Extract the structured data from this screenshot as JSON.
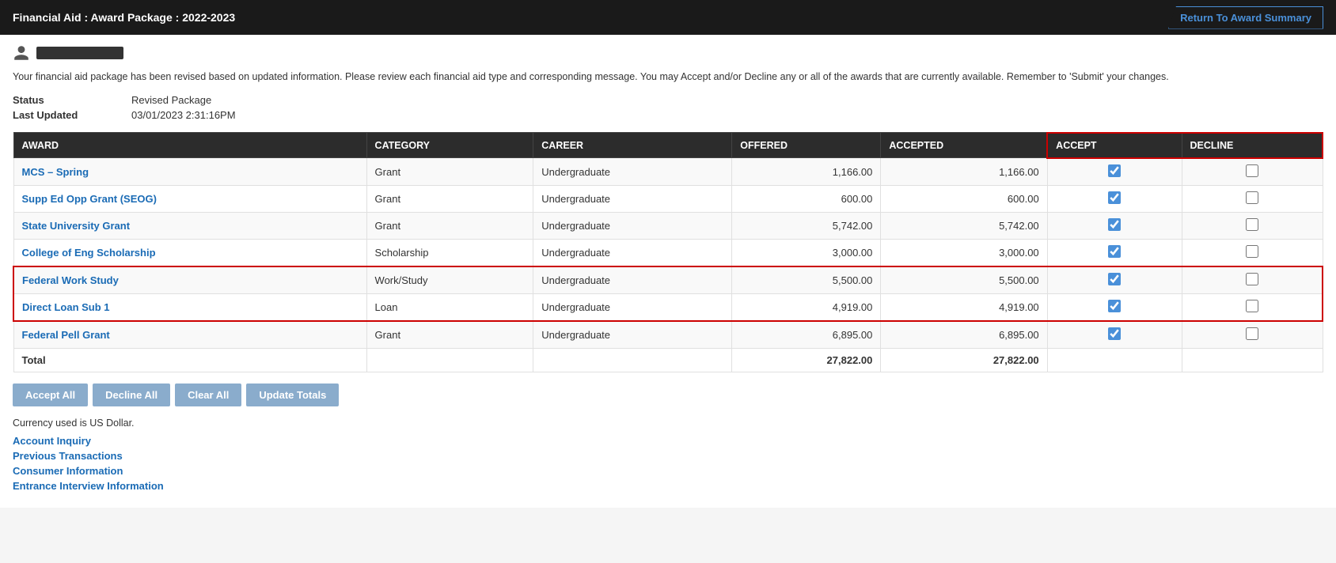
{
  "header": {
    "title": "Financial Aid  :  Award Package  :  2022-2023",
    "return_button_label": "Return To Award Summary"
  },
  "info_text": "Your financial aid package has been revised based on updated information. Please review each financial aid type and corresponding message. You may Accept and/or Decline any or all of the awards that are currently available. Remember to 'Submit' your changes.",
  "status": {
    "label": "Status",
    "value": "Revised Package"
  },
  "last_updated": {
    "label": "Last Updated",
    "value": "03/01/2023  2:31:16PM"
  },
  "table": {
    "columns": {
      "award": "AWARD",
      "category": "CATEGORY",
      "career": "CAREER",
      "offered": "OFFERED",
      "accepted": "ACCEPTED",
      "accept": "ACCEPT",
      "decline": "DECLINE"
    },
    "rows": [
      {
        "award": "MCS – Spring",
        "category": "Grant",
        "career": "Undergraduate",
        "offered": "1,166.00",
        "accepted": "1,166.00",
        "accept": true,
        "decline": false,
        "highlight": false
      },
      {
        "award": "Supp Ed Opp Grant (SEOG)",
        "category": "Grant",
        "career": "Undergraduate",
        "offered": "600.00",
        "accepted": "600.00",
        "accept": true,
        "decline": false,
        "highlight": false
      },
      {
        "award": "State University Grant",
        "category": "Grant",
        "career": "Undergraduate",
        "offered": "5,742.00",
        "accepted": "5,742.00",
        "accept": true,
        "decline": false,
        "highlight": false
      },
      {
        "award": "College of Eng Scholarship",
        "category": "Scholarship",
        "career": "Undergraduate",
        "offered": "3,000.00",
        "accepted": "3,000.00",
        "accept": true,
        "decline": false,
        "highlight": false
      },
      {
        "award": "Federal Work Study",
        "category": "Work/Study",
        "career": "Undergraduate",
        "offered": "5,500.00",
        "accepted": "5,500.00",
        "accept": true,
        "decline": false,
        "highlight": true,
        "highlight_top": true
      },
      {
        "award": "Direct Loan Sub 1",
        "category": "Loan",
        "career": "Undergraduate",
        "offered": "4,919.00",
        "accepted": "4,919.00",
        "accept": true,
        "decline": false,
        "highlight": true,
        "highlight_bottom": true
      },
      {
        "award": "Federal Pell Grant",
        "category": "Grant",
        "career": "Undergraduate",
        "offered": "6,895.00",
        "accepted": "6,895.00",
        "accept": true,
        "decline": false,
        "highlight": false
      }
    ],
    "total_row": {
      "label": "Total",
      "offered": "27,822.00",
      "accepted": "27,822.00"
    }
  },
  "buttons": {
    "accept_all": "Accept All",
    "decline_all": "Decline All",
    "clear_all": "Clear All",
    "update_totals": "Update Totals"
  },
  "currency_note": "Currency used is US Dollar.",
  "links": [
    {
      "label": "Account Inquiry",
      "name": "account-inquiry-link"
    },
    {
      "label": "Previous Transactions",
      "name": "previous-transactions-link"
    },
    {
      "label": "Consumer Information",
      "name": "consumer-information-link"
    },
    {
      "label": "Entrance Interview Information",
      "name": "entrance-interview-link"
    }
  ]
}
